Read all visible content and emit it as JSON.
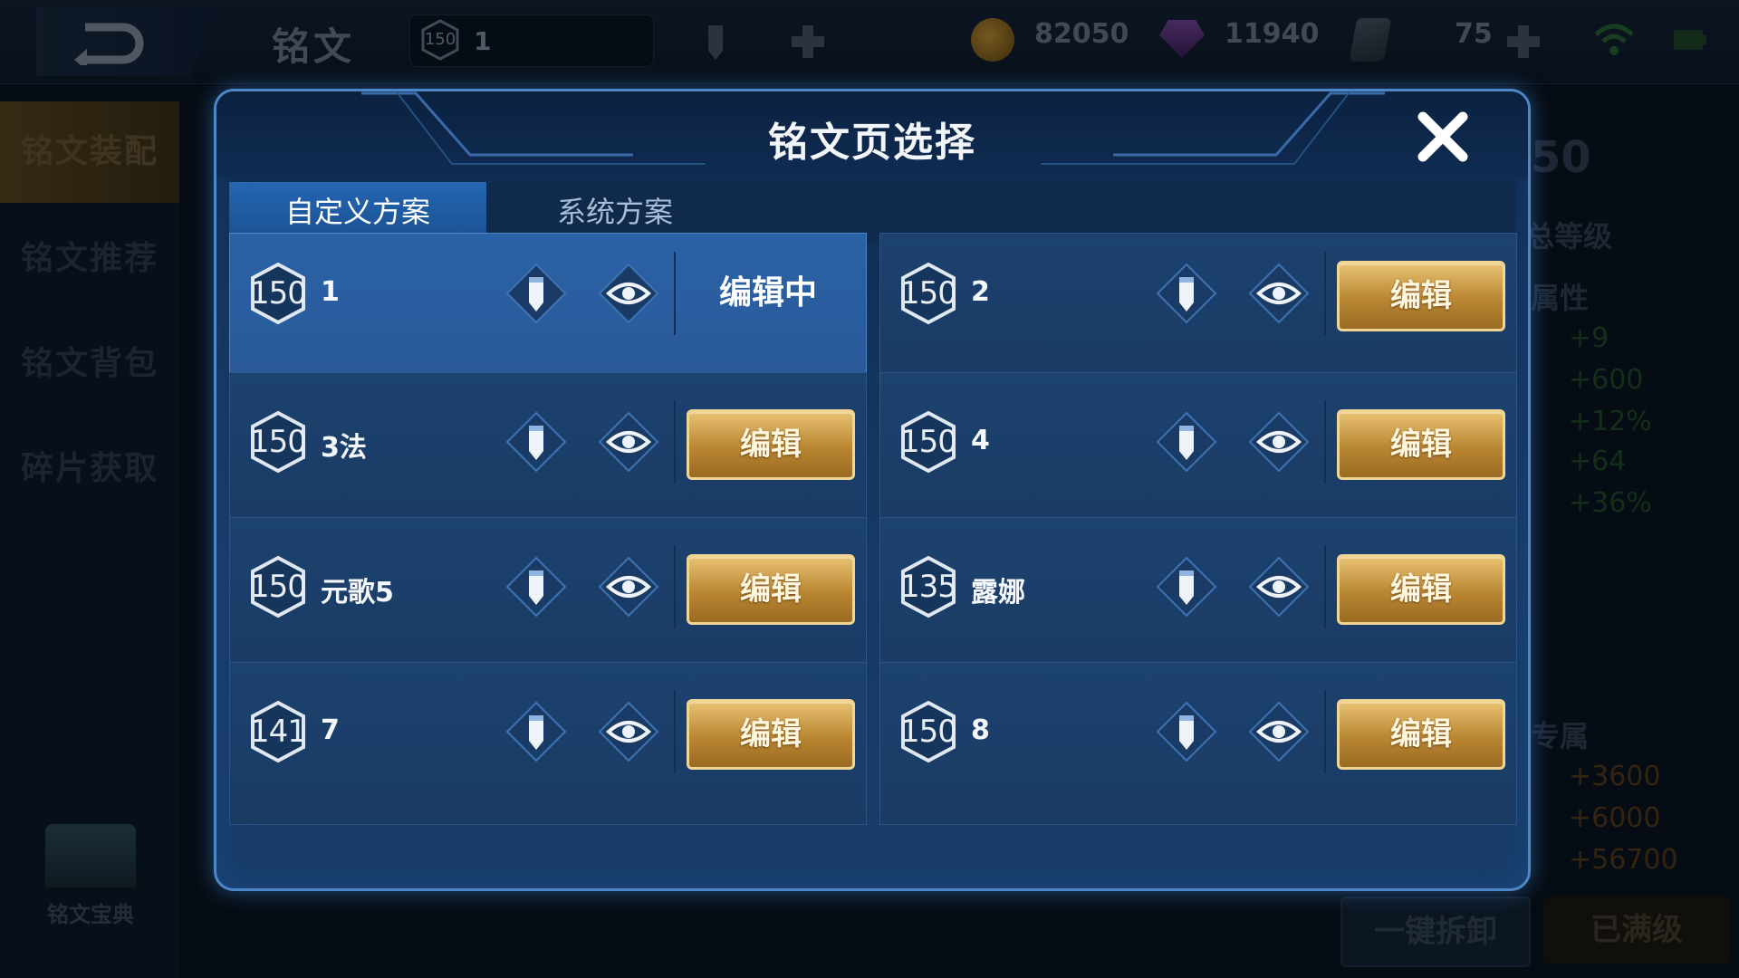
{
  "topbar": {
    "title": "铭文",
    "level_badge": "150",
    "page_number": "1",
    "gold": "82050",
    "gems": "11940",
    "tickets": "75"
  },
  "sidebar": {
    "items": [
      {
        "label": "铭文装配",
        "active": true
      },
      {
        "label": "铭文推荐",
        "active": false
      },
      {
        "label": "铭文背包",
        "active": false
      },
      {
        "label": "碎片获取",
        "active": false
      }
    ],
    "codex_label": "铭文宝典"
  },
  "right_panel": {
    "badge": "50",
    "total_level_label": "总等级",
    "attr_label": "属性",
    "attrs": [
      "+9",
      "+600",
      "+12%",
      "+64",
      "+36%"
    ],
    "exclusive_label": "专属",
    "exclusive_values": [
      "+3600",
      "+6000",
      "+56700"
    ],
    "unload_button": "一键拆卸",
    "maxed_button": "已满级"
  },
  "modal": {
    "title": "铭文页选择",
    "tabs": [
      {
        "label": "自定义方案",
        "active": true
      },
      {
        "label": "系统方案",
        "active": false
      }
    ],
    "edit_label": "编辑",
    "editing_label": "编辑中",
    "pages": [
      {
        "level": "150",
        "name": "1",
        "state": "editing"
      },
      {
        "level": "150",
        "name": "2",
        "state": "edit"
      },
      {
        "level": "150",
        "name": "3法",
        "state": "edit"
      },
      {
        "level": "150",
        "name": "4",
        "state": "edit"
      },
      {
        "level": "150",
        "name": "元歌5",
        "state": "edit"
      },
      {
        "level": "135",
        "name": "露娜",
        "state": "edit"
      },
      {
        "level": "141",
        "name": "7",
        "state": "edit"
      },
      {
        "level": "150",
        "name": "8",
        "state": "edit"
      }
    ]
  },
  "icons": {
    "rename": "pencil-icon",
    "preview": "eye-icon",
    "close": "close-icon",
    "back": "back-arrow-icon",
    "level": "hexagon-level-icon"
  },
  "colors": {
    "accent_gold": "#d4a44c",
    "modal_border": "#4e87c8",
    "selected_card": "#2a62a6",
    "tab_active": "#2467b3"
  }
}
